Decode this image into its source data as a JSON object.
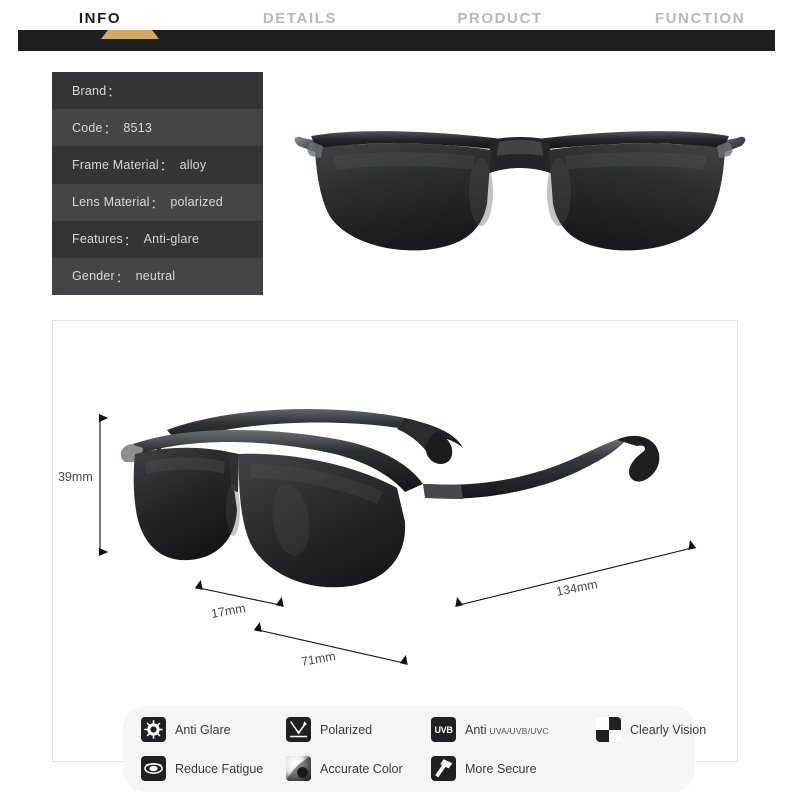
{
  "tabs": [
    {
      "label": "INFO",
      "active": true
    },
    {
      "label": "DETAILS",
      "active": false
    },
    {
      "label": "PRODUCT",
      "active": false
    },
    {
      "label": "FUNCTION",
      "active": false
    }
  ],
  "spec_table": {
    "rows": [
      {
        "label": "Brand",
        "colon": "：",
        "value": ""
      },
      {
        "label": "Code",
        "colon": "：",
        "value": "8513"
      },
      {
        "label": "Frame Material",
        "colon": "：",
        "value": "alloy"
      },
      {
        "label": "Lens Material",
        "colon": "：",
        "value": "polarized"
      },
      {
        "label": "Features",
        "colon": "：",
        "value": "Anti-glare"
      },
      {
        "label": "Gender",
        "colon": "：",
        "value": "neutral"
      }
    ]
  },
  "dimensions": {
    "height": "39mm",
    "lens_height": "17mm",
    "front_width": "71mm",
    "temple_length": "134mm"
  },
  "features": [
    {
      "label": "Anti Glare",
      "sub": "",
      "icon": "sun-glare-icon"
    },
    {
      "label": "Polarized",
      "sub": "",
      "icon": "polarized-ray-icon"
    },
    {
      "label": "Anti",
      "sub": "UVA/UVB/UVC",
      "icon": "uvb-badge-icon"
    },
    {
      "label": "Clearly Vision",
      "sub": "",
      "icon": "checkerboard-icon"
    },
    {
      "label": "Reduce Fatigue",
      "sub": "",
      "icon": "eye-icon"
    },
    {
      "label": "Accurate Color",
      "sub": "",
      "icon": "color-swirl-icon"
    },
    {
      "label": "More Secure",
      "sub": "",
      "icon": "hammer-icon"
    }
  ],
  "colors": {
    "accent_gold": "#d2ab62",
    "tabbar_dark": "#1e1e1e",
    "spec_row_odd": "#333436",
    "spec_row_even": "#444547",
    "feature_panel_bg": "#f5f5f6",
    "panel_border": "#e3e3e3",
    "icon_dark": "#1f2022"
  }
}
